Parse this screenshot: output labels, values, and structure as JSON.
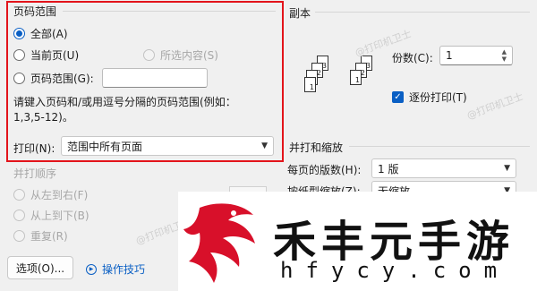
{
  "page_range": {
    "group_title": "页码范围",
    "all": "全部(A)",
    "current": "当前页(U)",
    "selection": "所选内容(S)",
    "pages_label": "页码范围(G):",
    "pages_value": "",
    "hint": "请键入页码和/或用逗号分隔的页码范围(例如：1,3,5-12)。"
  },
  "print_what": {
    "label": "打印(N):",
    "value": "范围中所有页面"
  },
  "collate_order": {
    "group_title": "并打顺序",
    "left_to_right": "从左到右(F)",
    "top_to_bottom": "从上到下(B)",
    "repeat": "重复(R)"
  },
  "copies": {
    "group_title": "副本",
    "count_label": "份数(C):",
    "count_value": "1",
    "collate_label": "逐份打印(T)"
  },
  "zoom": {
    "group_title": "并打和缩放",
    "pages_per_sheet_label": "每页的版数(H):",
    "pages_per_sheet_value": "1 版",
    "scale_label": "按纸型缩放(Z):",
    "scale_value": "无缩放"
  },
  "footer": {
    "options_button": "选项(O)...",
    "tips_link": "操作技巧"
  },
  "watermark": "@打印机卫士",
  "banner": {
    "title": "禾丰元手游",
    "url": "hfycy.com"
  },
  "colors": {
    "highlight": "#e3141b",
    "accent": "#0a5fc4"
  }
}
